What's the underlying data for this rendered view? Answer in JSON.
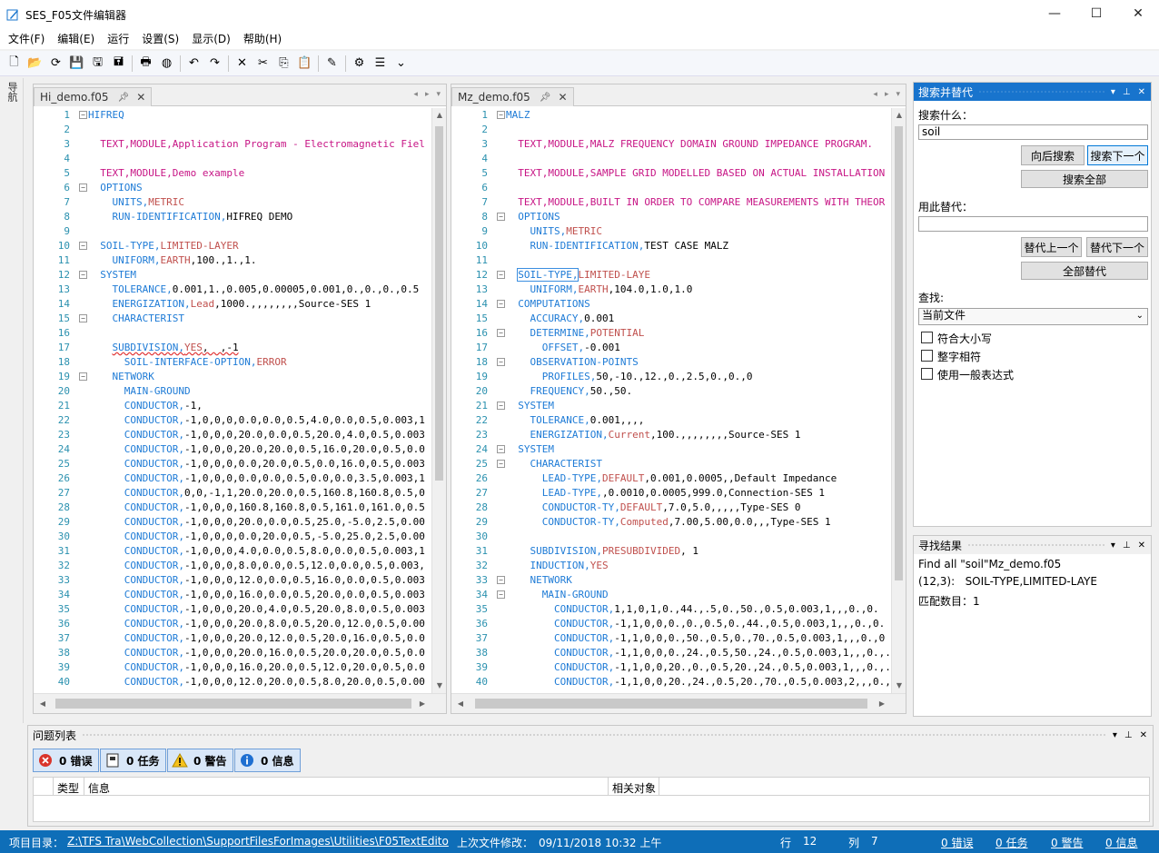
{
  "window": {
    "title": "SES_F05文件编辑器",
    "minimize": "—",
    "maximize": "☐",
    "close": "✕"
  },
  "menu": [
    "文件(F)",
    "编辑(E)",
    "运行",
    "设置(S)",
    "显示(D)",
    "帮助(H)"
  ],
  "nav_tab": "导航",
  "toolbar": [
    {
      "name": "new-file-icon",
      "glyph": "🗋"
    },
    {
      "name": "open-folder-icon",
      "glyph": "📂"
    },
    {
      "name": "refresh-icon",
      "glyph": "⟳"
    },
    {
      "name": "save-icon",
      "glyph": "💾"
    },
    {
      "name": "save-as-icon",
      "glyph": "🖫"
    },
    {
      "name": "save-all-icon",
      "glyph": "🖬"
    },
    {
      "sep": true
    },
    {
      "name": "print-icon",
      "glyph": "🖶"
    },
    {
      "name": "color-icon",
      "glyph": "◍"
    },
    {
      "sep": true
    },
    {
      "name": "undo-icon",
      "glyph": "↶"
    },
    {
      "name": "redo-icon",
      "glyph": "↷"
    },
    {
      "sep": true
    },
    {
      "name": "delete-icon",
      "glyph": "✕"
    },
    {
      "name": "cut-icon",
      "glyph": "✂"
    },
    {
      "name": "copy-icon",
      "glyph": "⎘"
    },
    {
      "name": "paste-icon",
      "glyph": "📋"
    },
    {
      "sep": true
    },
    {
      "name": "edit-icon",
      "glyph": "✎"
    },
    {
      "sep": true
    },
    {
      "name": "settings-icon",
      "glyph": "⚙"
    },
    {
      "name": "format-icon",
      "glyph": "☰"
    },
    {
      "name": "overflow-icon",
      "glyph": "⌄"
    }
  ],
  "editor_left": {
    "tab": "Hi_demo.f05",
    "lines": [
      {
        "n": "1",
        "f": "-",
        "i": 0,
        "s": [
          [
            "b",
            "HIFREQ"
          ]
        ]
      },
      {
        "n": "2",
        "i": 0,
        "s": []
      },
      {
        "n": "3",
        "i": 2,
        "s": [
          [
            "t",
            "TEXT,MODULE,Application Program - Electromagnetic Fiel"
          ]
        ]
      },
      {
        "n": "4",
        "i": 0,
        "s": []
      },
      {
        "n": "5",
        "i": 2,
        "s": [
          [
            "t",
            "TEXT,MODULE,Demo example"
          ]
        ]
      },
      {
        "n": "6",
        "f": "-",
        "i": 2,
        "s": [
          [
            "b",
            "OPTIONS"
          ]
        ]
      },
      {
        "n": "7",
        "i": 4,
        "s": [
          [
            "b",
            "UNITS,"
          ],
          [
            "r",
            "METRIC"
          ]
        ]
      },
      {
        "n": "8",
        "i": 4,
        "s": [
          [
            "b",
            "RUN-IDENTIFICATION,"
          ],
          [
            "n",
            "HIFREQ DEMO"
          ]
        ]
      },
      {
        "n": "9",
        "i": 0,
        "s": []
      },
      {
        "n": "10",
        "f": "-",
        "i": 2,
        "s": [
          [
            "b",
            "SOIL-TYPE,"
          ],
          [
            "r",
            "LIMITED-LAYER"
          ]
        ]
      },
      {
        "n": "11",
        "i": 4,
        "s": [
          [
            "b",
            "UNIFORM,"
          ],
          [
            "r",
            "EARTH"
          ],
          [
            "n",
            ",100.,1.,1."
          ]
        ]
      },
      {
        "n": "12",
        "f": "-",
        "i": 2,
        "s": [
          [
            "b",
            "SYSTEM"
          ]
        ]
      },
      {
        "n": "13",
        "i": 4,
        "s": [
          [
            "b",
            "TOLERANCE,"
          ],
          [
            "n",
            "0.001,1.,0.005,0.00005,0.001,0.,0.,0.,0.5"
          ]
        ]
      },
      {
        "n": "14",
        "i": 4,
        "s": [
          [
            "b",
            "ENERGIZATION,"
          ],
          [
            "r",
            "Lead"
          ],
          [
            "n",
            ",1000.,,,,,,,,Source-SES 1"
          ]
        ]
      },
      {
        "n": "15",
        "f": "-",
        "i": 4,
        "s": [
          [
            "b",
            "CHARACTERIST"
          ]
        ]
      },
      {
        "n": "16",
        "i": 0,
        "s": []
      },
      {
        "n": "17",
        "i": 4,
        "s": [
          [
            "b",
            "SUBDIVISION,"
          ],
          [
            "r",
            "YES"
          ],
          [
            "n",
            ",  ,-1"
          ]
        ]
      },
      {
        "n": "18",
        "i": 6,
        "s": [
          [
            "b",
            "SOIL-INTERFACE-OPTION,"
          ],
          [
            "r",
            "ERROR"
          ]
        ]
      },
      {
        "n": "19",
        "f": "-",
        "i": 4,
        "s": [
          [
            "b",
            "NETWORK"
          ]
        ]
      },
      {
        "n": "20",
        "i": 6,
        "s": [
          [
            "b",
            "MAIN-GROUND"
          ]
        ]
      },
      {
        "n": "21",
        "i": 6,
        "s": [
          [
            "b",
            "CONDUCTOR,"
          ],
          [
            "n",
            "-1,"
          ]
        ]
      },
      {
        "n": "22",
        "i": 6,
        "s": [
          [
            "b",
            "CONDUCTOR,"
          ],
          [
            "n",
            "-1,0,0,0,0.0,0.0,0.5,4.0,0.0,0.5,0.003,1"
          ]
        ]
      },
      {
        "n": "23",
        "i": 6,
        "s": [
          [
            "b",
            "CONDUCTOR,"
          ],
          [
            "n",
            "-1,0,0,0,20.0,0.0,0.5,20.0,4.0,0.5,0.003"
          ]
        ]
      },
      {
        "n": "24",
        "i": 6,
        "s": [
          [
            "b",
            "CONDUCTOR,"
          ],
          [
            "n",
            "-1,0,0,0,20.0,20.0,0.5,16.0,20.0,0.5,0.0"
          ]
        ]
      },
      {
        "n": "25",
        "i": 6,
        "s": [
          [
            "b",
            "CONDUCTOR,"
          ],
          [
            "n",
            "-1,0,0,0,0.0,20.0,0.5,0.0,16.0,0.5,0.003"
          ]
        ]
      },
      {
        "n": "26",
        "i": 6,
        "s": [
          [
            "b",
            "CONDUCTOR,"
          ],
          [
            "n",
            "-1,0,0,0,0.0,0.0,0.5,0.0,0.0,3.5,0.003,1"
          ]
        ]
      },
      {
        "n": "27",
        "i": 6,
        "s": [
          [
            "b",
            "CONDUCTOR,"
          ],
          [
            "n",
            "0,0,-1,1,20.0,20.0,0.5,160.8,160.8,0.5,0"
          ]
        ]
      },
      {
        "n": "28",
        "i": 6,
        "s": [
          [
            "b",
            "CONDUCTOR,"
          ],
          [
            "n",
            "-1,0,0,0,160.8,160.8,0.5,161.0,161.0,0.5"
          ]
        ]
      },
      {
        "n": "29",
        "i": 6,
        "s": [
          [
            "b",
            "CONDUCTOR,"
          ],
          [
            "n",
            "-1,0,0,0,20.0,0.0,0.5,25.0,-5.0,2.5,0.00"
          ]
        ]
      },
      {
        "n": "30",
        "i": 6,
        "s": [
          [
            "b",
            "CONDUCTOR,"
          ],
          [
            "n",
            "-1,0,0,0,0.0,20.0,0.5,-5.0,25.0,2.5,0.00"
          ]
        ]
      },
      {
        "n": "31",
        "i": 6,
        "s": [
          [
            "b",
            "CONDUCTOR,"
          ],
          [
            "n",
            "-1,0,0,0,4.0,0.0,0.5,8.0,0.0,0.5,0.003,1"
          ]
        ]
      },
      {
        "n": "32",
        "i": 6,
        "s": [
          [
            "b",
            "CONDUCTOR,"
          ],
          [
            "n",
            "-1,0,0,0,8.0,0.0,0.5,12.0,0.0,0.5,0.003,"
          ]
        ]
      },
      {
        "n": "33",
        "i": 6,
        "s": [
          [
            "b",
            "CONDUCTOR,"
          ],
          [
            "n",
            "-1,0,0,0,12.0,0.0,0.5,16.0,0.0,0.5,0.003"
          ]
        ]
      },
      {
        "n": "34",
        "i": 6,
        "s": [
          [
            "b",
            "CONDUCTOR,"
          ],
          [
            "n",
            "-1,0,0,0,16.0,0.0,0.5,20.0,0.0,0.5,0.003"
          ]
        ]
      },
      {
        "n": "35",
        "i": 6,
        "s": [
          [
            "b",
            "CONDUCTOR,"
          ],
          [
            "n",
            "-1,0,0,0,20.0,4.0,0.5,20.0,8.0,0.5,0.003"
          ]
        ]
      },
      {
        "n": "36",
        "i": 6,
        "s": [
          [
            "b",
            "CONDUCTOR,"
          ],
          [
            "n",
            "-1,0,0,0,20.0,8.0,0.5,20.0,12.0,0.5,0.00"
          ]
        ]
      },
      {
        "n": "37",
        "i": 6,
        "s": [
          [
            "b",
            "CONDUCTOR,"
          ],
          [
            "n",
            "-1,0,0,0,20.0,12.0,0.5,20.0,16.0,0.5,0.0"
          ]
        ]
      },
      {
        "n": "38",
        "i": 6,
        "s": [
          [
            "b",
            "CONDUCTOR,"
          ],
          [
            "n",
            "-1,0,0,0,20.0,16.0,0.5,20.0,20.0,0.5,0.0"
          ]
        ]
      },
      {
        "n": "39",
        "i": 6,
        "s": [
          [
            "b",
            "CONDUCTOR,"
          ],
          [
            "n",
            "-1,0,0,0,16.0,20.0,0.5,12.0,20.0,0.5,0.0"
          ]
        ]
      },
      {
        "n": "40",
        "i": 6,
        "s": [
          [
            "b",
            "CONDUCTOR,"
          ],
          [
            "n",
            "-1,0,0,0,12.0,20.0,0.5,8.0,20.0,0.5,0.00"
          ]
        ]
      }
    ]
  },
  "editor_right": {
    "tab": "Mz_demo.f05",
    "lines": [
      {
        "n": "1",
        "f": "-",
        "i": 0,
        "s": [
          [
            "b",
            "MALZ"
          ]
        ]
      },
      {
        "n": "2",
        "i": 0,
        "s": []
      },
      {
        "n": "3",
        "i": 2,
        "s": [
          [
            "t",
            "TEXT,MODULE,MALZ FREQUENCY DOMAIN GROUND IMPEDANCE PROGRAM."
          ]
        ]
      },
      {
        "n": "4",
        "i": 0,
        "s": []
      },
      {
        "n": "5",
        "i": 2,
        "s": [
          [
            "t",
            "TEXT,MODULE,SAMPLE GRID MODELLED BASED ON ACTUAL INSTALLATION"
          ]
        ]
      },
      {
        "n": "6",
        "i": 0,
        "s": []
      },
      {
        "n": "7",
        "i": 2,
        "s": [
          [
            "t",
            "TEXT,MODULE,BUILT IN ORDER TO COMPARE MEASUREMENTS WITH THEOR"
          ]
        ]
      },
      {
        "n": "8",
        "f": "-",
        "i": 2,
        "s": [
          [
            "b",
            "OPTIONS"
          ]
        ]
      },
      {
        "n": "9",
        "i": 4,
        "s": [
          [
            "b",
            "UNITS,"
          ],
          [
            "r",
            "METRIC"
          ]
        ]
      },
      {
        "n": "10",
        "i": 4,
        "s": [
          [
            "b",
            "RUN-IDENTIFICATION,"
          ],
          [
            "n",
            "TEST CASE MALZ"
          ]
        ]
      },
      {
        "n": "11",
        "i": 0,
        "s": []
      },
      {
        "n": "12",
        "f": "-",
        "i": 2,
        "s": [
          [
            "b",
            "SOIL-TYPE,"
          ],
          [
            "r",
            "LIMITED-LAYE"
          ]
        ]
      },
      {
        "n": "13",
        "i": 4,
        "s": [
          [
            "b",
            "UNIFORM,"
          ],
          [
            "r",
            "EARTH"
          ],
          [
            "n",
            ",104.0,1.0,1.0"
          ]
        ]
      },
      {
        "n": "14",
        "f": "-",
        "i": 2,
        "s": [
          [
            "b",
            "COMPUTATIONS"
          ]
        ]
      },
      {
        "n": "15",
        "i": 4,
        "s": [
          [
            "b",
            "ACCURACY,"
          ],
          [
            "n",
            "0.001"
          ]
        ]
      },
      {
        "n": "16",
        "f": "-",
        "i": 4,
        "s": [
          [
            "b",
            "DETERMINE,"
          ],
          [
            "r",
            "POTENTIAL"
          ]
        ]
      },
      {
        "n": "17",
        "i": 6,
        "s": [
          [
            "b",
            "OFFSET,"
          ],
          [
            "n",
            "-0.001"
          ]
        ]
      },
      {
        "n": "18",
        "f": "-",
        "i": 4,
        "s": [
          [
            "b",
            "OBSERVATION-POINTS"
          ]
        ]
      },
      {
        "n": "19",
        "i": 6,
        "s": [
          [
            "b",
            "PROFILES,"
          ],
          [
            "n",
            "50,-10.,12.,0.,2.5,0.,0.,0"
          ]
        ]
      },
      {
        "n": "20",
        "i": 4,
        "s": [
          [
            "b",
            "FREQUENCY,"
          ],
          [
            "n",
            "50.,50."
          ]
        ]
      },
      {
        "n": "21",
        "f": "-",
        "i": 2,
        "s": [
          [
            "b",
            "SYSTEM"
          ]
        ]
      },
      {
        "n": "22",
        "i": 4,
        "s": [
          [
            "b",
            "TOLERANCE,"
          ],
          [
            "n",
            "0.001,,,,"
          ]
        ]
      },
      {
        "n": "23",
        "i": 4,
        "s": [
          [
            "b",
            "ENERGIZATION,"
          ],
          [
            "r",
            "Current"
          ],
          [
            "n",
            ",100.,,,,,,,,Source-SES 1"
          ]
        ]
      },
      {
        "n": "24",
        "f": "-",
        "i": 2,
        "s": [
          [
            "b",
            "SYSTEM"
          ]
        ]
      },
      {
        "n": "25",
        "f": "-",
        "i": 4,
        "s": [
          [
            "b",
            "CHARACTERIST"
          ]
        ]
      },
      {
        "n": "26",
        "i": 6,
        "s": [
          [
            "b",
            "LEAD-TYPE,"
          ],
          [
            "r",
            "DEFAULT"
          ],
          [
            "n",
            ",0.001,0.0005,,Default Impedance"
          ]
        ]
      },
      {
        "n": "27",
        "i": 6,
        "s": [
          [
            "b",
            "LEAD-TYPE,"
          ],
          [
            "n",
            ",0.0010,0.0005,999.0,Connection-SES 1"
          ]
        ]
      },
      {
        "n": "28",
        "i": 6,
        "s": [
          [
            "b",
            "CONDUCTOR-TY,"
          ],
          [
            "r",
            "DEFAULT"
          ],
          [
            "n",
            ",7.0,5.0,,,,,Type-SES 0"
          ]
        ]
      },
      {
        "n": "29",
        "i": 6,
        "s": [
          [
            "b",
            "CONDUCTOR-TY,"
          ],
          [
            "r",
            "Computed"
          ],
          [
            "n",
            ",7.00,5.00,0.0,,,Type-SES 1"
          ]
        ]
      },
      {
        "n": "30",
        "i": 0,
        "s": []
      },
      {
        "n": "31",
        "i": 4,
        "s": [
          [
            "b",
            "SUBDIVISION,"
          ],
          [
            "r",
            "PRESUBDIVIDED"
          ],
          [
            "n",
            ", 1"
          ]
        ]
      },
      {
        "n": "32",
        "i": 4,
        "s": [
          [
            "b",
            "INDUCTION,"
          ],
          [
            "r",
            "YES"
          ]
        ]
      },
      {
        "n": "33",
        "f": "-",
        "i": 4,
        "s": [
          [
            "b",
            "NETWORK"
          ]
        ]
      },
      {
        "n": "34",
        "f": "-",
        "i": 6,
        "s": [
          [
            "b",
            "MAIN-GROUND"
          ]
        ]
      },
      {
        "n": "35",
        "i": 8,
        "s": [
          [
            "b",
            "CONDUCTOR,"
          ],
          [
            "n",
            "1,1,0,1,0.,44.,.5,0.,50.,0.5,0.003,1,,,0.,0."
          ]
        ]
      },
      {
        "n": "36",
        "i": 8,
        "s": [
          [
            "b",
            "CONDUCTOR,"
          ],
          [
            "n",
            "-1,1,0,0,0.,0.,0.5,0.,44.,0.5,0.003,1,,,0.,0."
          ]
        ]
      },
      {
        "n": "37",
        "i": 8,
        "s": [
          [
            "b",
            "CONDUCTOR,"
          ],
          [
            "n",
            "-1,1,0,0,0.,50.,0.5,0.,70.,0.5,0.003,1,,,0.,0"
          ]
        ]
      },
      {
        "n": "38",
        "i": 8,
        "s": [
          [
            "b",
            "CONDUCTOR,"
          ],
          [
            "n",
            "-1,1,0,0,0.,24.,0.5,50.,24.,0.5,0.003,1,,,0.,."
          ]
        ]
      },
      {
        "n": "39",
        "i": 8,
        "s": [
          [
            "b",
            "CONDUCTOR,"
          ],
          [
            "n",
            "-1,1,0,0,20.,0.,0.5,20.,24.,0.5,0.003,1,,,0.,."
          ]
        ]
      },
      {
        "n": "40",
        "i": 8,
        "s": [
          [
            "b",
            "CONDUCTOR,"
          ],
          [
            "n",
            "-1,1,0,0,20.,24.,0.5,20.,70.,0.5,0.003,2,,,0.,0."
          ]
        ]
      }
    ]
  },
  "search_panel": {
    "title": "搜索并替代",
    "find_label": "搜索什么：",
    "find_value": "soil",
    "find_prev": "向后搜索",
    "find_next": "搜索下一个",
    "find_all": "搜索全部",
    "replace_label": "用此替代：",
    "replace_value": "",
    "replace_prev": "替代上一个",
    "replace_next": "替代下一个",
    "replace_all": "全部替代",
    "scope_label": "查找:",
    "scope_value": "当前文件",
    "opt_case": "符合大小写",
    "opt_word": "整字相符",
    "opt_regex": "使用一般表达式"
  },
  "results_panel": {
    "title": "寻找结果",
    "line1": "Find all \"soil\"Mz_demo.f05",
    "line2": "(12,3):   SOIL-TYPE,LIMITED-LAYE",
    "line3": "匹配数目：1"
  },
  "problems_panel": {
    "title": "问题列表",
    "errors": "0 错误",
    "tasks": "0 任务",
    "warnings": "0 警告",
    "info": "0 信息",
    "col_type": "类型",
    "col_info": "信息",
    "col_related": "相关对象"
  },
  "statusbar": {
    "project_label": "项目目录：",
    "project_path": "Z:\\TFS Tra\\WebCollection\\SupportFilesForImages\\Utilities\\F05TextEdito",
    "modified_label": "上次文件修改：",
    "modified_value": "09/11/2018 10:32 上午",
    "row_label": "行",
    "row_value": "12",
    "col_label": "列",
    "col_value": "7",
    "errors": "0 错误",
    "tasks": "0 任务",
    "warnings": "0 警告",
    "info": "0 信息"
  },
  "colors": {
    "accent": "#1874cd",
    "status": "#0e6eb8",
    "keyword": "#1e7bd6",
    "value": "#c0504d",
    "text": "#c71585",
    "linenum": "#2b91af"
  }
}
